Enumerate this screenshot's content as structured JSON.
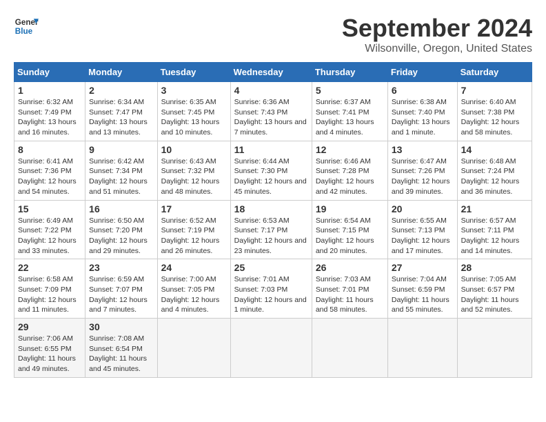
{
  "logo": {
    "line1": "General",
    "line2": "Blue"
  },
  "title": "September 2024",
  "location": "Wilsonville, Oregon, United States",
  "days_of_week": [
    "Sunday",
    "Monday",
    "Tuesday",
    "Wednesday",
    "Thursday",
    "Friday",
    "Saturday"
  ],
  "weeks": [
    [
      {
        "day": "1",
        "sunrise": "6:32 AM",
        "sunset": "7:49 PM",
        "daylight": "13 hours and 16 minutes."
      },
      {
        "day": "2",
        "sunrise": "6:34 AM",
        "sunset": "7:47 PM",
        "daylight": "13 hours and 13 minutes."
      },
      {
        "day": "3",
        "sunrise": "6:35 AM",
        "sunset": "7:45 PM",
        "daylight": "13 hours and 10 minutes."
      },
      {
        "day": "4",
        "sunrise": "6:36 AM",
        "sunset": "7:43 PM",
        "daylight": "13 hours and 7 minutes."
      },
      {
        "day": "5",
        "sunrise": "6:37 AM",
        "sunset": "7:41 PM",
        "daylight": "13 hours and 4 minutes."
      },
      {
        "day": "6",
        "sunrise": "6:38 AM",
        "sunset": "7:40 PM",
        "daylight": "13 hours and 1 minute."
      },
      {
        "day": "7",
        "sunrise": "6:40 AM",
        "sunset": "7:38 PM",
        "daylight": "12 hours and 58 minutes."
      }
    ],
    [
      {
        "day": "8",
        "sunrise": "6:41 AM",
        "sunset": "7:36 PM",
        "daylight": "12 hours and 54 minutes."
      },
      {
        "day": "9",
        "sunrise": "6:42 AM",
        "sunset": "7:34 PM",
        "daylight": "12 hours and 51 minutes."
      },
      {
        "day": "10",
        "sunrise": "6:43 AM",
        "sunset": "7:32 PM",
        "daylight": "12 hours and 48 minutes."
      },
      {
        "day": "11",
        "sunrise": "6:44 AM",
        "sunset": "7:30 PM",
        "daylight": "12 hours and 45 minutes."
      },
      {
        "day": "12",
        "sunrise": "6:46 AM",
        "sunset": "7:28 PM",
        "daylight": "12 hours and 42 minutes."
      },
      {
        "day": "13",
        "sunrise": "6:47 AM",
        "sunset": "7:26 PM",
        "daylight": "12 hours and 39 minutes."
      },
      {
        "day": "14",
        "sunrise": "6:48 AM",
        "sunset": "7:24 PM",
        "daylight": "12 hours and 36 minutes."
      }
    ],
    [
      {
        "day": "15",
        "sunrise": "6:49 AM",
        "sunset": "7:22 PM",
        "daylight": "12 hours and 33 minutes."
      },
      {
        "day": "16",
        "sunrise": "6:50 AM",
        "sunset": "7:20 PM",
        "daylight": "12 hours and 29 minutes."
      },
      {
        "day": "17",
        "sunrise": "6:52 AM",
        "sunset": "7:19 PM",
        "daylight": "12 hours and 26 minutes."
      },
      {
        "day": "18",
        "sunrise": "6:53 AM",
        "sunset": "7:17 PM",
        "daylight": "12 hours and 23 minutes."
      },
      {
        "day": "19",
        "sunrise": "6:54 AM",
        "sunset": "7:15 PM",
        "daylight": "12 hours and 20 minutes."
      },
      {
        "day": "20",
        "sunrise": "6:55 AM",
        "sunset": "7:13 PM",
        "daylight": "12 hours and 17 minutes."
      },
      {
        "day": "21",
        "sunrise": "6:57 AM",
        "sunset": "7:11 PM",
        "daylight": "12 hours and 14 minutes."
      }
    ],
    [
      {
        "day": "22",
        "sunrise": "6:58 AM",
        "sunset": "7:09 PM",
        "daylight": "12 hours and 11 minutes."
      },
      {
        "day": "23",
        "sunrise": "6:59 AM",
        "sunset": "7:07 PM",
        "daylight": "12 hours and 7 minutes."
      },
      {
        "day": "24",
        "sunrise": "7:00 AM",
        "sunset": "7:05 PM",
        "daylight": "12 hours and 4 minutes."
      },
      {
        "day": "25",
        "sunrise": "7:01 AM",
        "sunset": "7:03 PM",
        "daylight": "12 hours and 1 minute."
      },
      {
        "day": "26",
        "sunrise": "7:03 AM",
        "sunset": "7:01 PM",
        "daylight": "11 hours and 58 minutes."
      },
      {
        "day": "27",
        "sunrise": "7:04 AM",
        "sunset": "6:59 PM",
        "daylight": "11 hours and 55 minutes."
      },
      {
        "day": "28",
        "sunrise": "7:05 AM",
        "sunset": "6:57 PM",
        "daylight": "11 hours and 52 minutes."
      }
    ],
    [
      {
        "day": "29",
        "sunrise": "7:06 AM",
        "sunset": "6:55 PM",
        "daylight": "11 hours and 49 minutes."
      },
      {
        "day": "30",
        "sunrise": "7:08 AM",
        "sunset": "6:54 PM",
        "daylight": "11 hours and 45 minutes."
      },
      null,
      null,
      null,
      null,
      null
    ]
  ]
}
